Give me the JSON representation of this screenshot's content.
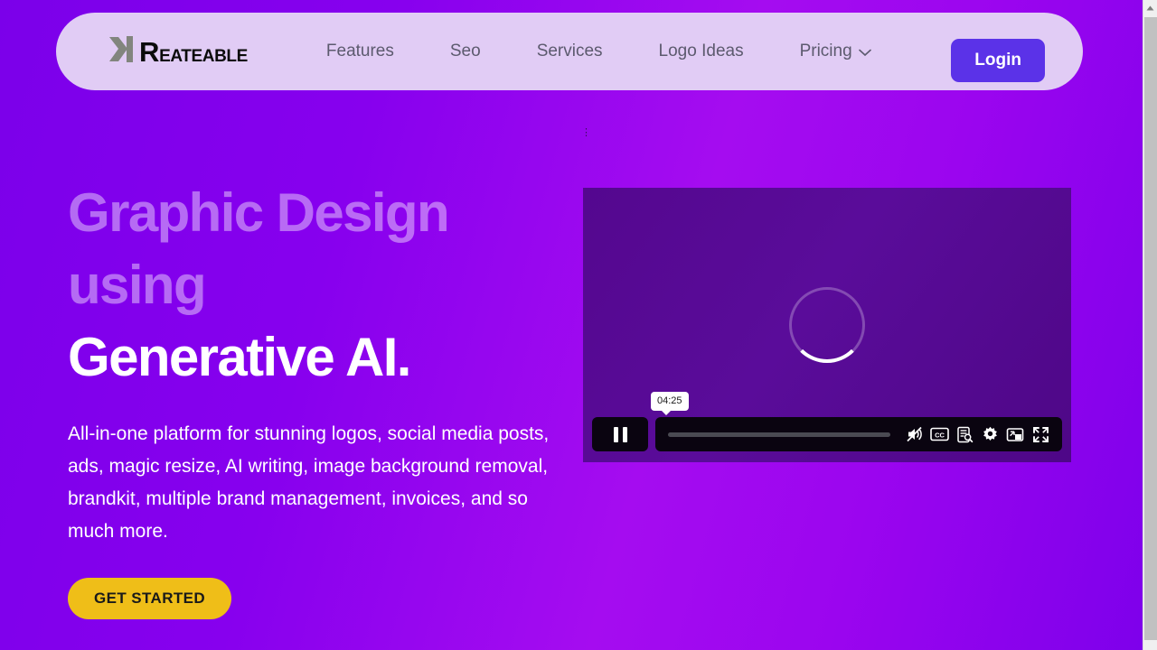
{
  "brand": {
    "logo_mark": "k-chevron-mark",
    "logo_cap": "R",
    "logo_rest": "EATEABLE",
    "accent_purple": "#5B32E8",
    "accent_yellow": "#EFBE18",
    "header_bg": "#E1CCF5",
    "page_bg_from": "#7B00EA",
    "page_bg_to": "#A50CF0"
  },
  "header": {
    "nav": [
      {
        "label": "Features"
      },
      {
        "label": "Seo"
      },
      {
        "label": "Services"
      },
      {
        "label": "Logo Ideas"
      },
      {
        "label": "Pricing",
        "chevron": "⌄"
      }
    ],
    "login_label": "Login"
  },
  "hero": {
    "headline_faded": "Graphic Design using",
    "headline_solid": "Generative AI.",
    "subcopy": "All-in-one platform for stunning logos, social media posts, ads, magic resize, AI writing, image background removal, brandkit, multiple brand management, invoices, and so much more.",
    "cta_label": "GET STARTED"
  },
  "video": {
    "state": "loading",
    "spinner": "loading-spinner",
    "tooltip_time": "04:25",
    "play_state": "pause",
    "progress_percent": 0,
    "controls": [
      {
        "name": "volume-muted-icon",
        "label": "Mute"
      },
      {
        "name": "closed-captions-icon",
        "label": "CC"
      },
      {
        "name": "transcript-icon",
        "label": "Transcript"
      },
      {
        "name": "settings-gear-icon",
        "label": "Settings"
      },
      {
        "name": "picture-in-picture-icon",
        "label": "Picture in picture"
      },
      {
        "name": "fullscreen-icon",
        "label": "Fullscreen"
      }
    ]
  },
  "artifact": {
    "glyph": "⋮"
  },
  "scrollbar": {
    "up_arrow": "▲"
  }
}
